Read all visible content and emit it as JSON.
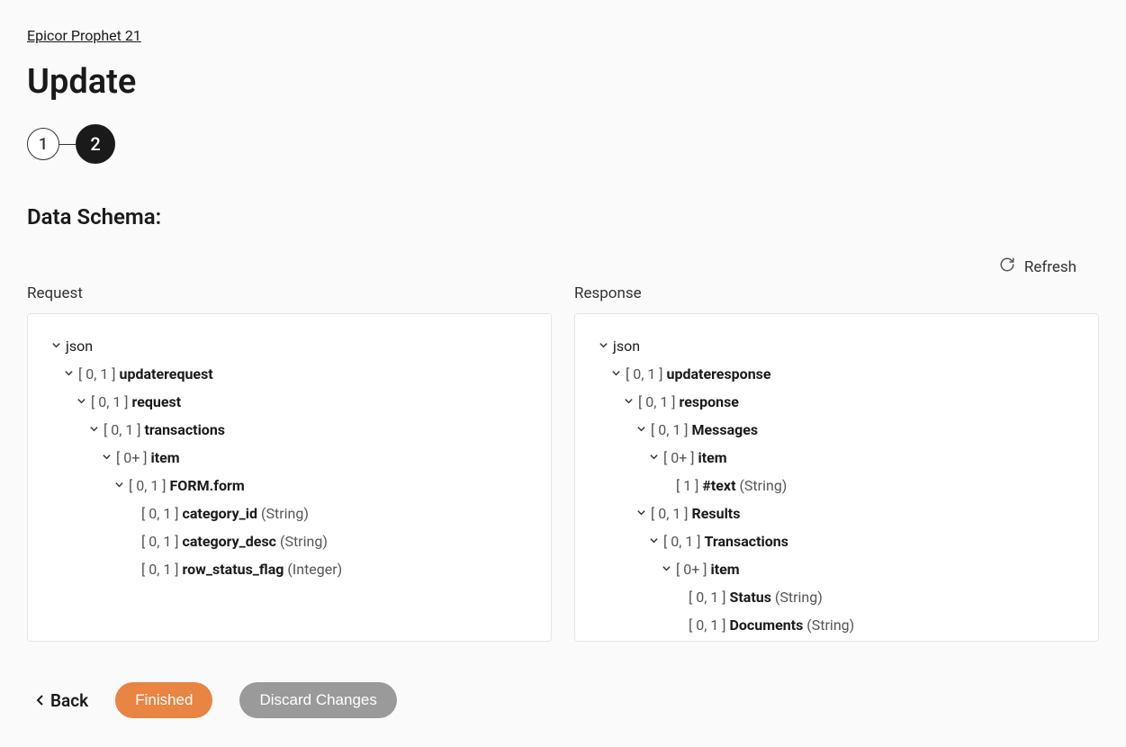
{
  "breadcrumb": "Epicor Prophet 21",
  "page_title": "Update",
  "stepper": {
    "step1": "1",
    "step2": "2"
  },
  "section_title": "Data Schema:",
  "refresh_label": "Refresh",
  "columns": {
    "request": "Request",
    "response": "Response"
  },
  "request_tree": [
    {
      "indent": 0,
      "chevron": true,
      "card": "",
      "name": "json",
      "plain": true
    },
    {
      "indent": 1,
      "chevron": true,
      "card": "[ 0, 1 ]",
      "name": "updaterequest"
    },
    {
      "indent": 2,
      "chevron": true,
      "card": "[ 0, 1 ]",
      "name": "request"
    },
    {
      "indent": 3,
      "chevron": true,
      "card": "[ 0, 1 ]",
      "name": "transactions"
    },
    {
      "indent": 4,
      "chevron": true,
      "card": "[ 0+ ]",
      "name": "item"
    },
    {
      "indent": 5,
      "chevron": true,
      "card": "[ 0, 1 ]",
      "name": "FORM.form"
    },
    {
      "indent": 6,
      "chevron": false,
      "card": "[ 0, 1 ]",
      "name": "category_id",
      "type": "(String)"
    },
    {
      "indent": 6,
      "chevron": false,
      "card": "[ 0, 1 ]",
      "name": "category_desc",
      "type": "(String)"
    },
    {
      "indent": 6,
      "chevron": false,
      "card": "[ 0, 1 ]",
      "name": "row_status_flag",
      "type": "(Integer)"
    }
  ],
  "response_tree": [
    {
      "indent": 0,
      "chevron": true,
      "card": "",
      "name": "json",
      "plain": true
    },
    {
      "indent": 1,
      "chevron": true,
      "card": "[ 0, 1 ]",
      "name": "updateresponse"
    },
    {
      "indent": 2,
      "chevron": true,
      "card": "[ 0, 1 ]",
      "name": "response"
    },
    {
      "indent": 3,
      "chevron": true,
      "card": "[ 0, 1 ]",
      "name": "Messages"
    },
    {
      "indent": 4,
      "chevron": true,
      "card": "[ 0+ ]",
      "name": "item"
    },
    {
      "indent": 5,
      "chevron": false,
      "card": "[ 1 ]",
      "name": "#text",
      "type": "(String)"
    },
    {
      "indent": 3,
      "chevron": true,
      "card": "[ 0, 1 ]",
      "name": "Results"
    },
    {
      "indent": 4,
      "chevron": true,
      "card": "[ 0, 1 ]",
      "name": "Transactions"
    },
    {
      "indent": 5,
      "chevron": true,
      "card": "[ 0+ ]",
      "name": "item"
    },
    {
      "indent": 6,
      "chevron": false,
      "card": "[ 0, 1 ]",
      "name": "Status",
      "type": "(String)"
    },
    {
      "indent": 6,
      "chevron": false,
      "card": "[ 0, 1 ]",
      "name": "Documents",
      "type": "(String)"
    }
  ],
  "footer": {
    "back": "Back",
    "finished": "Finished",
    "discard": "Discard Changes"
  }
}
